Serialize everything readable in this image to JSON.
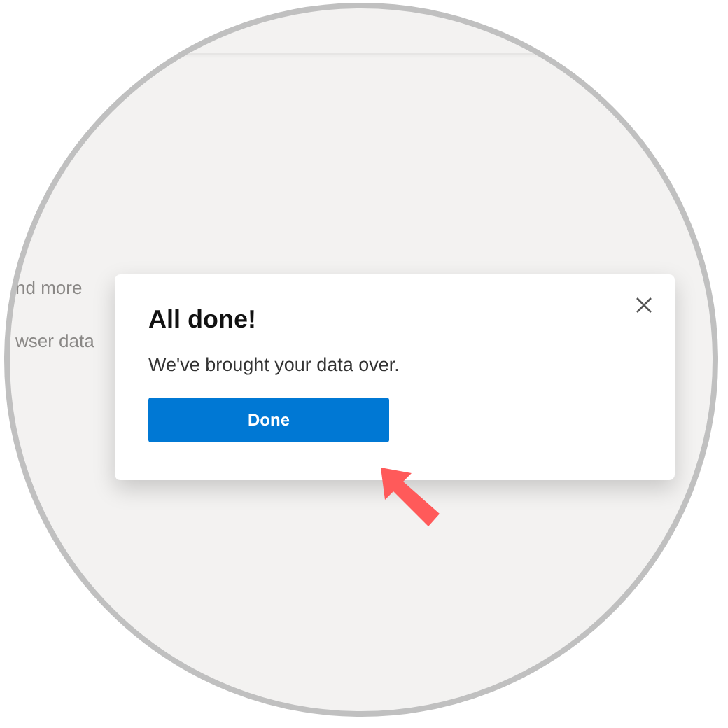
{
  "background_texts": [
    "nd more",
    "wser data"
  ],
  "dialog": {
    "title": "All done!",
    "message": "We've brought your data over.",
    "button": "Done"
  }
}
